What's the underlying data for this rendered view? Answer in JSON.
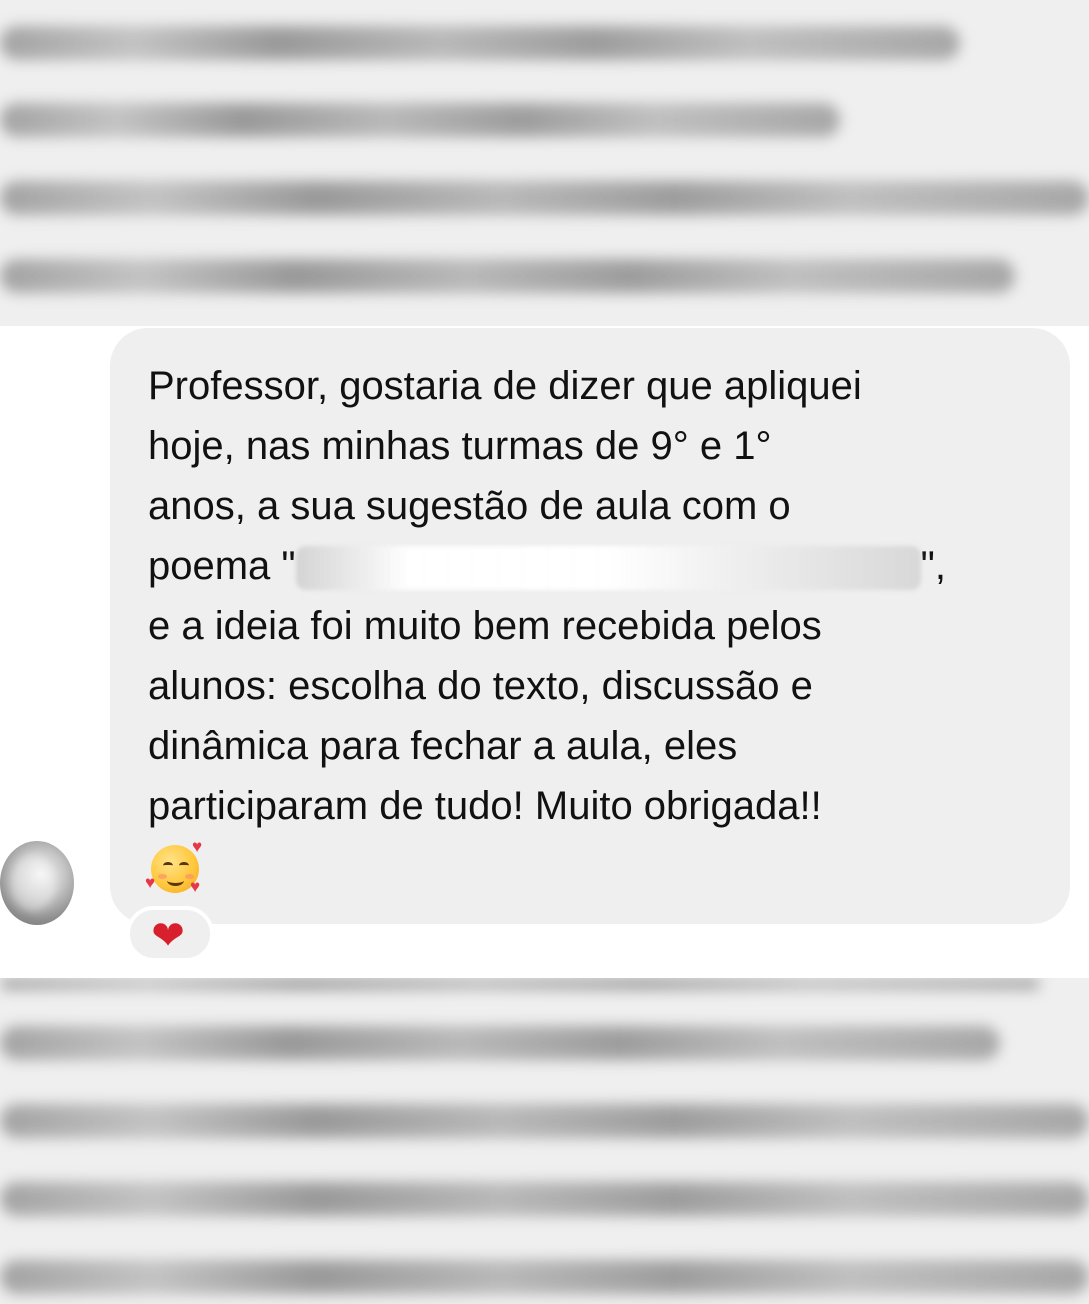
{
  "message": {
    "lines": [
      "Professor, gostaria de dizer que apliquei",
      "hoje, nas minhas turmas de 9° e 1°",
      "anos, a sua sugestão de aula com o",
      "poema \"",
      "e a ideia foi muito bem recebida pelos",
      "alunos: escolha do texto, discussão e",
      "dinâmica para fechar a aula, eles",
      "participaram de tudo! Muito obrigada!!"
    ],
    "redacted_suffix": "\",",
    "emoji_icon": "smiling-face-with-hearts-icon"
  },
  "reaction": {
    "icon": "red-heart-icon",
    "glyph": "❤"
  },
  "colors": {
    "bubble_background": "#efefef",
    "text": "#111111",
    "heart": "#d81f2d",
    "page_background": "#ffffff"
  }
}
